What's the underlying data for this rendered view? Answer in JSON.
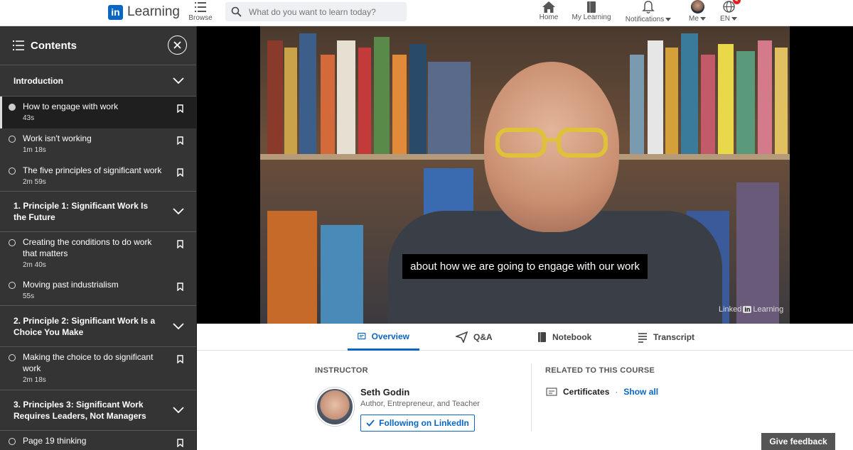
{
  "nav": {
    "logo_mark": "in",
    "logo_text": "Learning",
    "browse": "Browse",
    "search_placeholder": "What do you want to learn today?",
    "home": "Home",
    "my_learning": "My Learning",
    "notifications": "Notifications",
    "me": "Me",
    "language": "EN",
    "globe_badge": "4"
  },
  "sidebar": {
    "title": "Contents",
    "sections": [
      {
        "title": "Introduction",
        "lessons": [
          {
            "title": "How to engage with work",
            "duration": "43s",
            "active": true
          },
          {
            "title": "Work isn't working",
            "duration": "1m 18s"
          },
          {
            "title": "The five principles of significant work",
            "duration": "2m 59s"
          }
        ]
      },
      {
        "title": "1. Principle 1: Significant Work Is the Future",
        "lessons": [
          {
            "title": "Creating the conditions to do work that matters",
            "duration": "2m 40s"
          },
          {
            "title": "Moving past industrialism",
            "duration": "55s"
          }
        ]
      },
      {
        "title": "2. Principle 2: Significant Work Is a Choice You Make",
        "lessons": [
          {
            "title": "Making the choice to do significant work",
            "duration": "2m 18s"
          }
        ]
      },
      {
        "title": "3. Principles 3: Significant Work Requires Leaders, Not Managers",
        "lessons": [
          {
            "title": "Page 19 thinking",
            "duration": ""
          }
        ]
      }
    ]
  },
  "video": {
    "caption": "about how we are going to engage with our work",
    "watermark_left": "Linked",
    "watermark_in": "in",
    "watermark_right": "Learning"
  },
  "tabs": {
    "overview": "Overview",
    "qa": "Q&A",
    "notebook": "Notebook",
    "transcript": "Transcript"
  },
  "overview": {
    "instructor_label": "INSTRUCTOR",
    "instructor_name": "Seth Godin",
    "instructor_title": "Author, Entrepreneur, and Teacher",
    "follow_button": "Following on LinkedIn",
    "related_label": "RELATED TO THIS COURSE",
    "certificates": "Certificates",
    "separator": "·",
    "show_all": "Show all"
  },
  "feedback_button": "Give feedback",
  "colors": {
    "brand": "#0a66c2",
    "sidebar_bg": "#343434",
    "badge": "#e02020"
  }
}
